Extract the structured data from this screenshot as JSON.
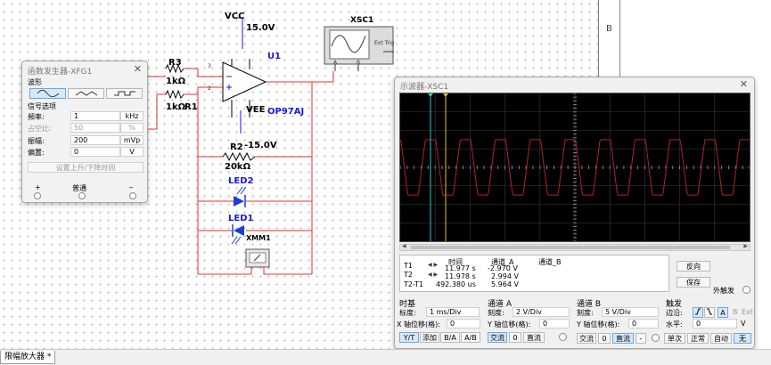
{
  "schematic": {
    "vcc_label": "VCC",
    "vcc_value": "15.0V",
    "vee_label": "VEE",
    "vee_value": "-15.0V",
    "opamp_ref": "U1",
    "opamp_model": "OP97AJ",
    "r3_ref": "R3",
    "r3_value": "1kΩ",
    "r1_ref": "R1",
    "r1_value": "1kΩ",
    "r2_ref": "R2",
    "r2_value": "20kΩ",
    "led2_ref": "LED2",
    "led1_ref": "LED1",
    "xmm_ref": "XMM1",
    "xsc_ref": "XSC1",
    "ext_trig": "Ext Trig",
    "ch_a": "A",
    "ch_b": "B",
    "pin_plus": "3",
    "pin_minus": "2",
    "sheet_col": "B"
  },
  "function_generator": {
    "title": "函数发生器-XFG1",
    "waveform_label": "波形",
    "signal_options_label": "信号选项",
    "rows": [
      {
        "label": "频率:",
        "value": "1",
        "unit": "kHz",
        "disabled": false
      },
      {
        "label": "占空比:",
        "value": "50",
        "unit": "%",
        "disabled": true
      },
      {
        "label": "振幅:",
        "value": "200",
        "unit": "mVp",
        "disabled": false
      },
      {
        "label": "偏置:",
        "value": "0",
        "unit": "V",
        "disabled": false
      }
    ],
    "set_rise_fall": "设置上升/下降时间",
    "terminal_plus": "+",
    "terminal_common": "普通",
    "terminal_minus": "_"
  },
  "oscilloscope": {
    "title": "示波器-XSC1",
    "readout": {
      "col_time": "时间",
      "col_ch_a": "通道_A",
      "col_ch_b": "通道_B",
      "t1": "T1",
      "t2": "T2",
      "t2_t1": "T2-T1",
      "t1_time": "11.977 s",
      "t1_a": "-2.970 V",
      "t2_time": "11.978 s",
      "t2_a": "2.994 V",
      "dt_time": "492.380 us",
      "dt_a": "5.964 V"
    },
    "reverse_button": "反向",
    "save_button": "保存",
    "ext_trigger": "外触发",
    "timebase": {
      "label": "时基",
      "scale_label": "标度:",
      "scale_value": "1 ms/Div",
      "xpos_label": "X 轴位移(格):",
      "xpos_value": "0",
      "mode_yt": "Y/T",
      "mode_add": "添加",
      "mode_ba": "B/A",
      "mode_ab": "A/B"
    },
    "channel_a": {
      "label": "通道 A",
      "scale_label": "刻度:",
      "scale_value": "2  V/Div",
      "ypos_label": "Y 轴位移(格):",
      "ypos_value": "0",
      "ac": "交流",
      "zero": "0",
      "dc": "直流"
    },
    "channel_b": {
      "label": "通道 B",
      "scale_label": "刻度:",
      "scale_value": "5  V/Div",
      "ypos_label": "Y 轴位移(格):",
      "ypos_value": "0",
      "ac": "交流",
      "zero": "0",
      "dc": "直流",
      "minus": "-"
    },
    "trigger": {
      "label": "触发",
      "edge_label": "边沿:",
      "level_label": "水平:",
      "level_value": "0",
      "level_unit": "V",
      "src_a": "A",
      "src_b": "B",
      "src_ext": "Ext",
      "single": "单次",
      "normal": "正常",
      "auto": "自动",
      "none": "无"
    }
  },
  "taskbar": {
    "tab_label": "限幅放大器 *"
  },
  "colors": {
    "wire": "#e0322f",
    "trace_a": "#b3202a",
    "cursor_t1": "#3cc6c6",
    "cursor_t2": "#e7c22a",
    "led": "#1a3fd6",
    "label_blue": "#1a1adb"
  }
}
